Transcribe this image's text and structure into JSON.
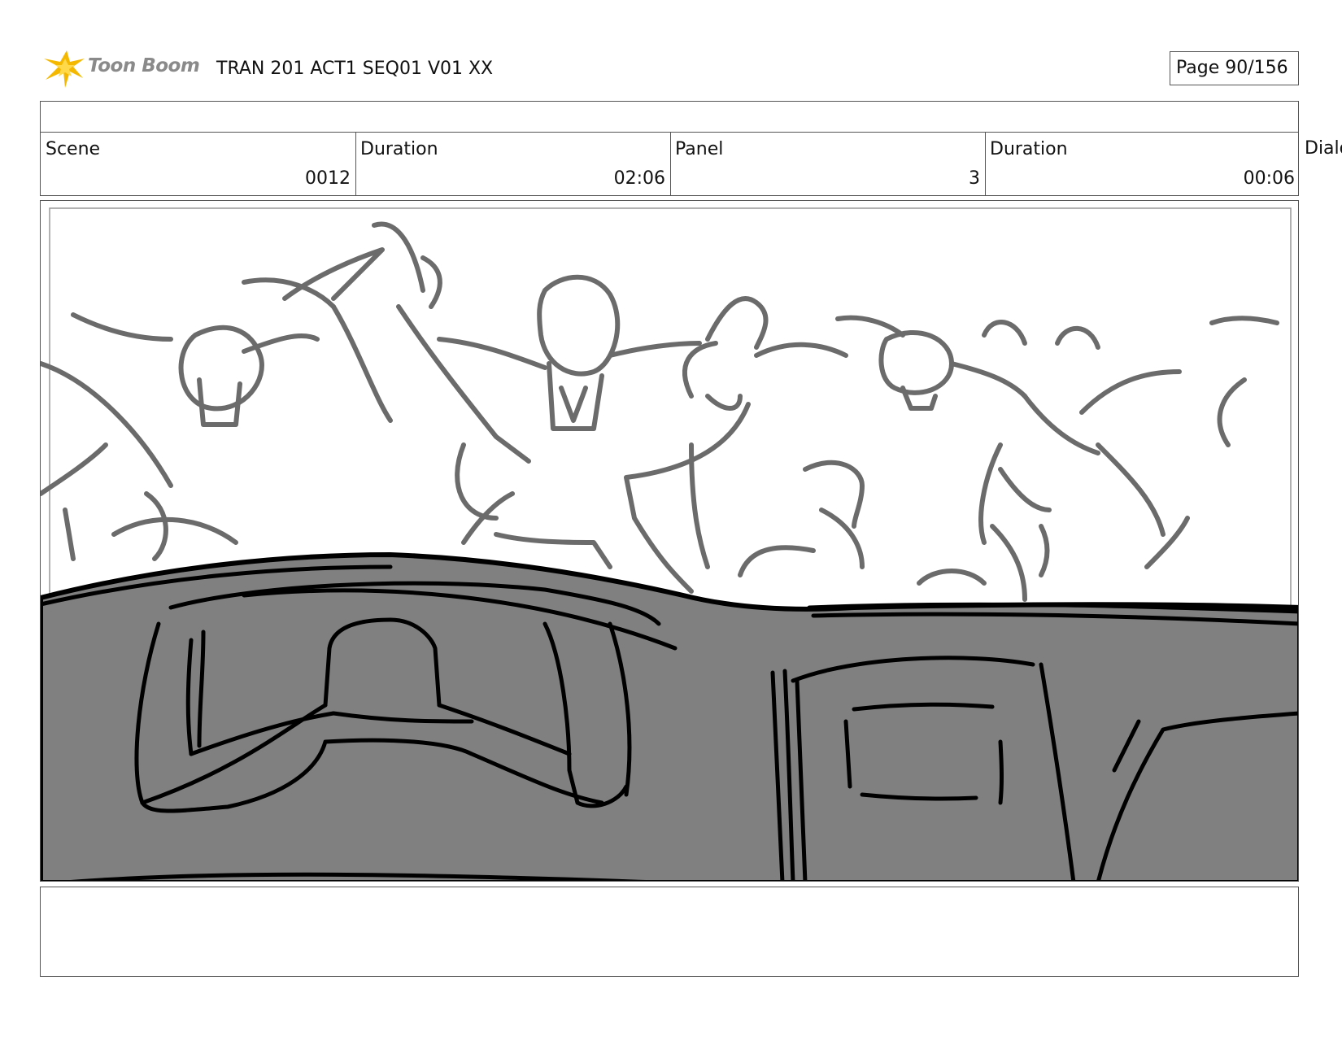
{
  "header": {
    "logo_text": "Toon Boom",
    "document_title": "TRAN 201 ACT1 SEQ01 V01 XX",
    "page_indicator": "Page  90/156"
  },
  "info": {
    "scene_label": "Scene",
    "scene_value": "0012",
    "scene_duration_label": "Duration",
    "scene_duration_value": "02:06",
    "panel_label": "Panel",
    "panel_value": "3",
    "panel_duration_label": "Duration",
    "panel_duration_value": "00:06",
    "dialog_label": "Dialo"
  },
  "colors": {
    "logo_star": "#f5b800",
    "sketch_line": "#6b6b6b",
    "foreground_fill": "#808080",
    "ink": "#000000"
  },
  "icons": {
    "logo": "toon-boom-star-icon"
  }
}
